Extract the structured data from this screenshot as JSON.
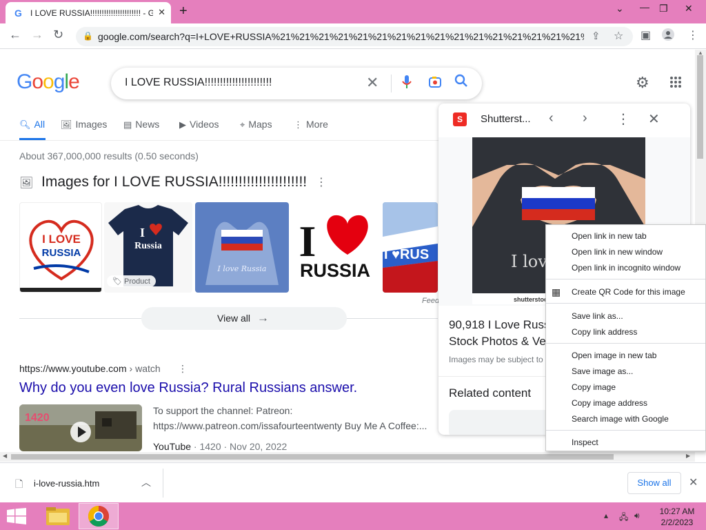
{
  "browser": {
    "tab_title": "I LOVE RUSSIA!!!!!!!!!!!!!!!!!!!!!! - Go",
    "url": "google.com/search?q=I+LOVE+RUSSIA%21%21%21%21%21%21%21%21%21%21%21%21%21%21%21%21%21%21%21..."
  },
  "google": {
    "logo": [
      "G",
      "o",
      "o",
      "g",
      "l",
      "e"
    ],
    "logo_colors": [
      "#4285f4",
      "#ea4335",
      "#fbbc05",
      "#4285f4",
      "#34a853",
      "#ea4335"
    ],
    "query": "I LOVE RUSSIA!!!!!!!!!!!!!!!!!!!!!!",
    "tabs": [
      {
        "label": "All",
        "icon": "search-icon",
        "active": true
      },
      {
        "label": "Images",
        "icon": "image-icon",
        "active": false
      },
      {
        "label": "News",
        "icon": "news-icon",
        "active": false
      },
      {
        "label": "Videos",
        "icon": "video-icon",
        "active": false
      },
      {
        "label": "Maps",
        "icon": "map-pin-icon",
        "active": false
      },
      {
        "label": "More",
        "icon": "more-vert-icon",
        "active": false
      }
    ],
    "stats": "About 367,000,000 results (0.50 seconds)",
    "images_heading": "Images for I LOVE RUSSIA!!!!!!!!!!!!!!!!!!!!!!",
    "thumbs": {
      "t1_line1": "I LOVE",
      "t1_line2": "RUSSIA",
      "t2_line1": "I",
      "t2_line2": "Russia",
      "t2_badge": "Product",
      "t3_caption": "I love Russia",
      "t4_line1": "I",
      "t4_line2": "RUSSIA",
      "t5_text": "I ♥RUS"
    },
    "feedback": "Feed",
    "view_all": "View all",
    "result": {
      "site": "https://www.youtube.com",
      "path": " › watch",
      "title": "Why do you even love Russia? Rural Russians answer.",
      "snippet_line1": "To support the channel: Patreon:",
      "snippet_line2": "https://www.patreon.com/issafourteentwenty Buy Me A Coffee:...",
      "source": "YouTube",
      "meta": " · 1420 · Nov 20, 2022",
      "thumb_text": "1420"
    }
  },
  "side_panel": {
    "source_name": "Shutterst...",
    "image_caption": "I lov",
    "image_credit": "shutterstoc",
    "title_line1": "90,918 I Love Russ",
    "title_line2": "Stock Photos & Ve",
    "note": "Images may be subject to",
    "related": "Related content"
  },
  "context_menu": {
    "items": [
      "Open link in new tab",
      "Open link in new window",
      "Open link in incognito window",
      "Create QR Code for this image",
      "Save link as...",
      "Copy link address",
      "Open image in new tab",
      "Save image as...",
      "Copy image",
      "Copy image address",
      "Search image with Google",
      "Inspect"
    ]
  },
  "downloads": {
    "file": "i-love-russia.htm",
    "show_all": "Show all"
  },
  "taskbar": {
    "time": "10:27 AM",
    "date": "2/2/2023"
  },
  "colors": {
    "accent": "#1a73e8",
    "link": "#1a0dab",
    "titlebar": "#e57fbd"
  }
}
